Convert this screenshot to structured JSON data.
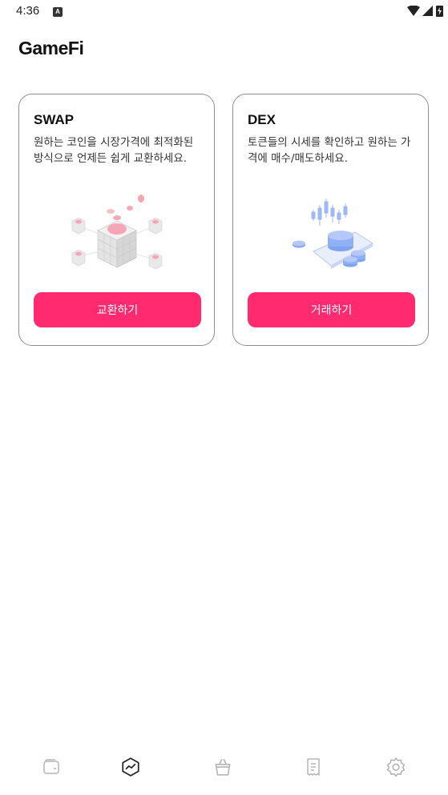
{
  "status_bar": {
    "time": "4:36",
    "notification_icon": "A"
  },
  "header": {
    "title": "GameFi"
  },
  "cards": [
    {
      "title": "SWAP",
      "description": "원하는 코인을 시장가격에 최적화된 방식으로 언제든 쉽게 교환하세요.",
      "button_label": "교환하기",
      "illustration_icon": "swap-cubes-illustration"
    },
    {
      "title": "DEX",
      "description": "토큰들의 시세를 확인하고 원하는 가격에 매수/매도하세요.",
      "button_label": "거래하기",
      "illustration_icon": "trading-coins-illustration"
    }
  ],
  "bottom_nav": [
    {
      "icon": "wallet-icon"
    },
    {
      "icon": "chart-icon",
      "active": true
    },
    {
      "icon": "shopping-bag-icon"
    },
    {
      "icon": "receipt-icon"
    },
    {
      "icon": "settings-icon"
    }
  ],
  "colors": {
    "accent": "#ff2a6f",
    "card_border": "#8e8e8e",
    "text": "#111111"
  }
}
